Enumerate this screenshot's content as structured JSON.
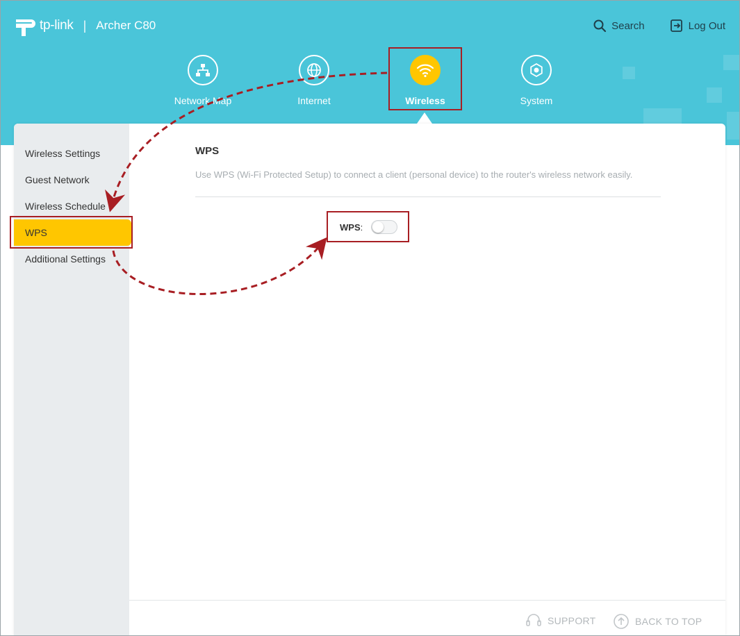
{
  "brand": {
    "logo_text": "tp-link",
    "separator": "|",
    "model": "Archer C80"
  },
  "top_actions": {
    "search_label": "Search",
    "logout_label": "Log Out"
  },
  "nav": [
    {
      "label": "Network Map",
      "icon": "network-map-icon",
      "active": false
    },
    {
      "label": "Internet",
      "icon": "globe-icon",
      "active": false
    },
    {
      "label": "Wireless",
      "icon": "wifi-icon",
      "active": true
    },
    {
      "label": "System",
      "icon": "gear-icon",
      "active": false
    }
  ],
  "sidebar": {
    "items": [
      {
        "label": "Wireless Settings",
        "active": false
      },
      {
        "label": "Guest Network",
        "active": false
      },
      {
        "label": "Wireless Schedule",
        "active": false
      },
      {
        "label": "WPS",
        "active": true
      },
      {
        "label": "Additional Settings",
        "active": false
      }
    ]
  },
  "content": {
    "title": "WPS",
    "description": "Use WPS (Wi-Fi Protected Setup) to connect a client (personal device) to the router's wireless network easily.",
    "wps_label": "WPS",
    "wps_colon": ":",
    "wps_enabled": false
  },
  "footer": {
    "support_label": "SUPPORT",
    "back_to_top_label": "BACK TO TOP"
  },
  "colors": {
    "header_bg": "#4ac5d9",
    "accent": "#ffc600",
    "annotation_red": "#a81e23",
    "sidebar_bg": "#e9ecee"
  }
}
